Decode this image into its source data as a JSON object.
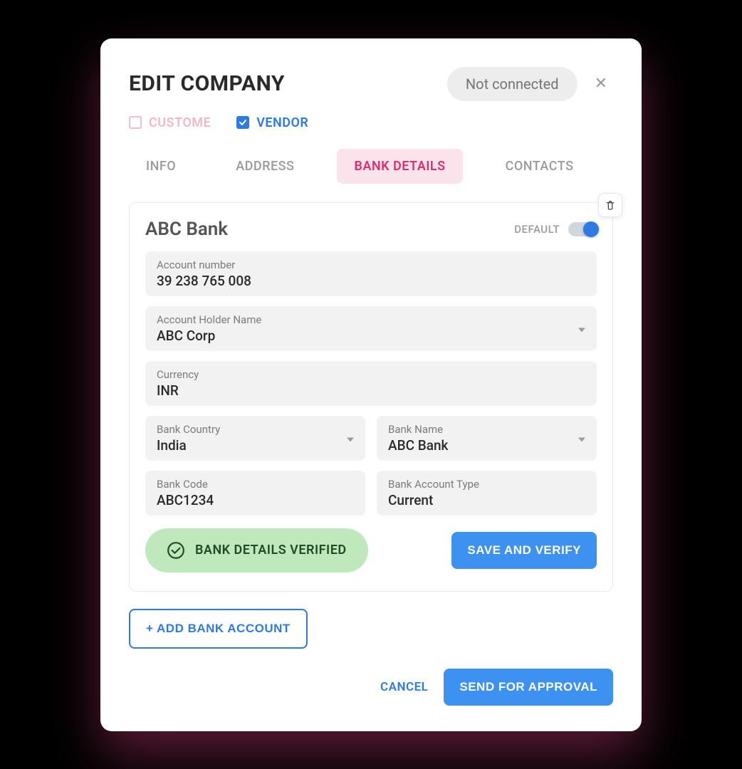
{
  "header": {
    "title": "EDIT COMPANY",
    "status": "Not connected"
  },
  "types": {
    "customer_label": "CUSTOME",
    "vendor_label": "VENDOR"
  },
  "tabs": [
    "INFO",
    "ADDRESS",
    "BANK DETAILS",
    "CONTACTS"
  ],
  "bank_card": {
    "title": "ABC Bank",
    "default_label": "DEFAULT",
    "fields": {
      "account_number": {
        "label": "Account number",
        "value": "39 238 765 008"
      },
      "holder_name": {
        "label": "Account Holder Name",
        "value": "ABC Corp"
      },
      "currency": {
        "label": "Currency",
        "value": "INR"
      },
      "bank_country": {
        "label": "Bank Country",
        "value": "India"
      },
      "bank_name": {
        "label": "Bank Name",
        "value": "ABC Bank"
      },
      "bank_code": {
        "label": "Bank Code",
        "value": "ABC1234"
      },
      "account_type": {
        "label": "Bank Account Type",
        "value": "Current"
      }
    },
    "verified_label": "BANK DETAILS VERIFIED",
    "save_verify_label": "SAVE AND VERIFY"
  },
  "actions": {
    "add_bank": "+ ADD BANK ACCOUNT",
    "cancel": "CANCEL",
    "send_for_approval": "SEND FOR APPROVAL"
  }
}
